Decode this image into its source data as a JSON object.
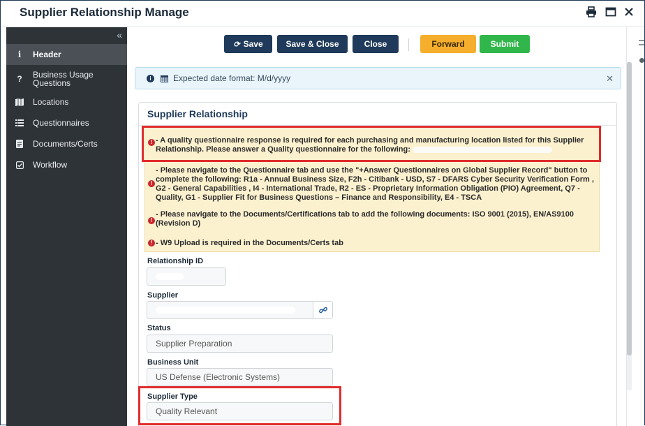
{
  "window": {
    "title": "Supplier Relationship Manage"
  },
  "sidebar": {
    "items": [
      {
        "label": "Header",
        "icon": "info-icon",
        "glyph": "i"
      },
      {
        "label": "Business Usage Questions",
        "icon": "question-icon",
        "glyph": "?"
      },
      {
        "label": "Locations",
        "icon": "map-icon",
        "glyph": "▮▮"
      },
      {
        "label": "Questionnaires",
        "icon": "list-icon",
        "glyph": "☰"
      },
      {
        "label": "Documents/Certs",
        "icon": "document-icon",
        "glyph": "▤"
      },
      {
        "label": "Workflow",
        "icon": "checkbox-icon",
        "glyph": "☑"
      }
    ]
  },
  "toolbar": {
    "save": "Save",
    "save_close": "Save & Close",
    "close": "Close",
    "forward": "Forward",
    "submit": "Submit"
  },
  "info": {
    "text": "Expected date format: M/d/yyyy"
  },
  "section": {
    "title": "Supplier Relationship"
  },
  "warnings": [
    "- A quality questionnaire response is required for each purchasing and manufacturing location listed for this Supplier Relationship. Please answer a Quality questionnaire for the following:",
    "- Please navigate to the Questionnaire tab and use the \"+Answer Questionnaires on Global Supplier Record\" button to complete the following: R1a - Annual Business Size, F2h - Citibank - USD, S7 - DFARS Cyber Security Verification Form , G2 - General Capabilities , I4 - International Trade, R2 - ES - Proprietary Information Obligation (PIO) Agreement, Q7 - Quality, G1 - Supplier Fit for Business Questions – Finance and Responsibility, E4 - TSCA",
    "- Please navigate to the Documents/Certifications tab to add the following documents: ISO 9001 (2015), EN/AS9100 (Revision D)",
    "- W9 Upload is required in the Documents/Certs tab"
  ],
  "fields": {
    "relationship_id": {
      "label": "Relationship ID",
      "value": ""
    },
    "supplier": {
      "label": "Supplier",
      "value": ""
    },
    "status": {
      "label": "Status",
      "value": "Supplier Preparation"
    },
    "business_unit": {
      "label": "Business Unit",
      "value": "US Defense (Electronic Systems)"
    },
    "supplier_type": {
      "label": "Supplier Type",
      "value": "Quality Relevant"
    }
  },
  "colors": {
    "navy": "#1f3a5a",
    "orange": "#f6ae2d",
    "green": "#30b64a",
    "highlight": "#e12c2c",
    "error": "#c9252c"
  }
}
